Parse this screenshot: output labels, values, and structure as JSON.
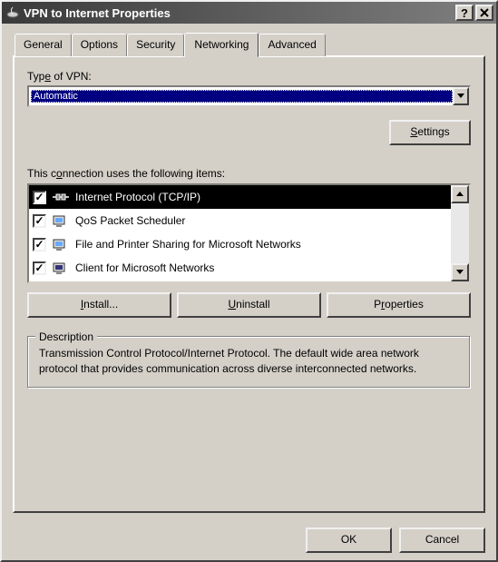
{
  "window": {
    "title": "VPN to Internet Properties"
  },
  "tabs": {
    "general": "General",
    "options": "Options",
    "security": "Security",
    "networking": "Networking",
    "advanced": "Advanced",
    "active": "networking"
  },
  "vpn_type": {
    "label_pre": "Typ",
    "label_u": "e",
    "label_post": " of VPN:",
    "value": "Automatic"
  },
  "buttons": {
    "settings": "Settings",
    "settings_u": "S",
    "install": "Install...",
    "install_u": "I",
    "uninstall": "Uninstall",
    "uninstall_u": "U",
    "properties": "Properties",
    "properties_u": "r",
    "ok": "OK",
    "cancel": "Cancel"
  },
  "connection_label_pre": "This c",
  "connection_label_u": "o",
  "connection_label_post": "nnection uses the following items:",
  "items": [
    {
      "checked": true,
      "label": "Internet Protocol (TCP/IP)",
      "icon": "network-protocol-icon",
      "selected": true
    },
    {
      "checked": true,
      "label": "QoS Packet Scheduler",
      "icon": "service-icon",
      "selected": false
    },
    {
      "checked": true,
      "label": "File and Printer Sharing for Microsoft Networks",
      "icon": "service-icon",
      "selected": false
    },
    {
      "checked": true,
      "label": "Client for Microsoft Networks",
      "icon": "client-icon",
      "selected": false
    }
  ],
  "description": {
    "legend": "Description",
    "text": "Transmission Control Protocol/Internet Protocol. The default wide area network protocol that provides communication across diverse interconnected networks."
  }
}
